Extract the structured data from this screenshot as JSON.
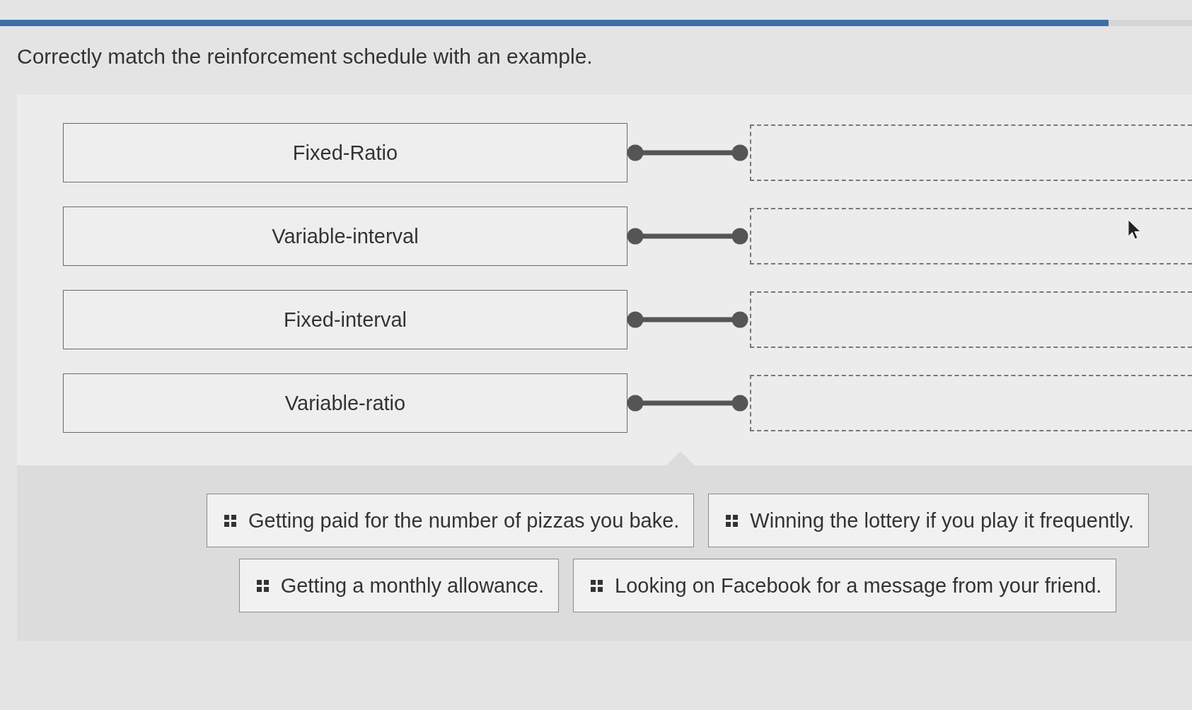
{
  "progress": {
    "level": 0.93
  },
  "question": "Correctly match the reinforcement schedule with an example.",
  "schedules": [
    {
      "label": "Fixed-Ratio"
    },
    {
      "label": "Variable-interval"
    },
    {
      "label": "Fixed-interval"
    },
    {
      "label": "Variable-ratio"
    }
  ],
  "answers": [
    {
      "text": "Getting paid for the number of pizzas you bake."
    },
    {
      "text": "Winning the lottery if you play it frequently."
    },
    {
      "text": "Getting a monthly allowance."
    },
    {
      "text": "Looking on Facebook for a message from your friend."
    }
  ]
}
